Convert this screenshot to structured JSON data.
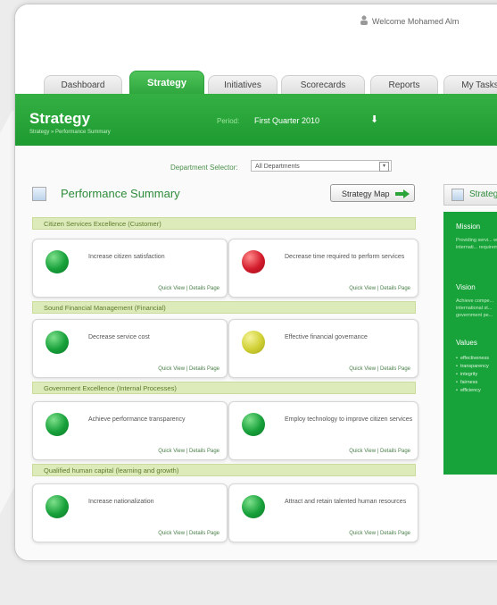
{
  "welcome": "Welcome Mohamed Alm",
  "tabs": [
    {
      "label": "Dashboard"
    },
    {
      "label": "Strategy"
    },
    {
      "label": "Initiatives"
    },
    {
      "label": "Scorecards"
    },
    {
      "label": "Reports"
    },
    {
      "label": "My Tasks"
    }
  ],
  "header": {
    "title": "Strategy",
    "breadcrumb": "Strategy » Performance Summary",
    "period_label": "Period:",
    "period_value": "First Quarter 2010"
  },
  "filter": {
    "label": "Department Selector:",
    "selected": "All Departments"
  },
  "summary": {
    "title": "Performance Summary",
    "strategy_map_button": "Strategy Map",
    "sections": [
      {
        "title": "Citizen Services Excellence (Customer)",
        "cards": [
          {
            "status": "green",
            "text": "Increase citizen satisfaction",
            "links": "Quick View | Details Page"
          },
          {
            "status": "red",
            "text": "Decrease time required to perform services",
            "links": "Quick View | Details Page"
          }
        ]
      },
      {
        "title": "Sound Financial Management (Financial)",
        "cards": [
          {
            "status": "green",
            "text": "Decrease service cost",
            "links": "Quick View | Details Page"
          },
          {
            "status": "yellow",
            "text": "Effective financial governance",
            "links": "Quick View | Details Page"
          }
        ]
      },
      {
        "title": "Government Excellence (Internal Processes)",
        "cards": [
          {
            "status": "green",
            "text": "Achieve performance transparency",
            "links": "Quick View | Details Page"
          },
          {
            "status": "green",
            "text": "Employ technology to improve citizen services",
            "links": "Quick View | Details Page"
          }
        ]
      },
      {
        "title": "Qualified human capital (learning and growth)",
        "cards": [
          {
            "status": "green",
            "text": "Increase nationalization",
            "links": "Quick View | Details Page"
          },
          {
            "status": "green",
            "text": "Attract and retain talented human resources",
            "links": "Quick View | Details Page"
          }
        ]
      }
    ]
  },
  "sidebar": {
    "title": "Strategy",
    "mission_title": "Mission",
    "mission_text": "Providing servi... with internati... requirement",
    "vision_title": "Vision",
    "vision_text": "Achieve compe... international st... government pe...",
    "values_title": "Values",
    "values": [
      "effectiveness",
      "transparency",
      "integrity",
      "fairness",
      "efficiency"
    ]
  },
  "colors": {
    "primary_green": "#1f9d32",
    "status_green": "#17a03a",
    "status_red": "#d21b2b",
    "status_yellow": "#cfcf33",
    "section_bg": "#dcebb9"
  }
}
